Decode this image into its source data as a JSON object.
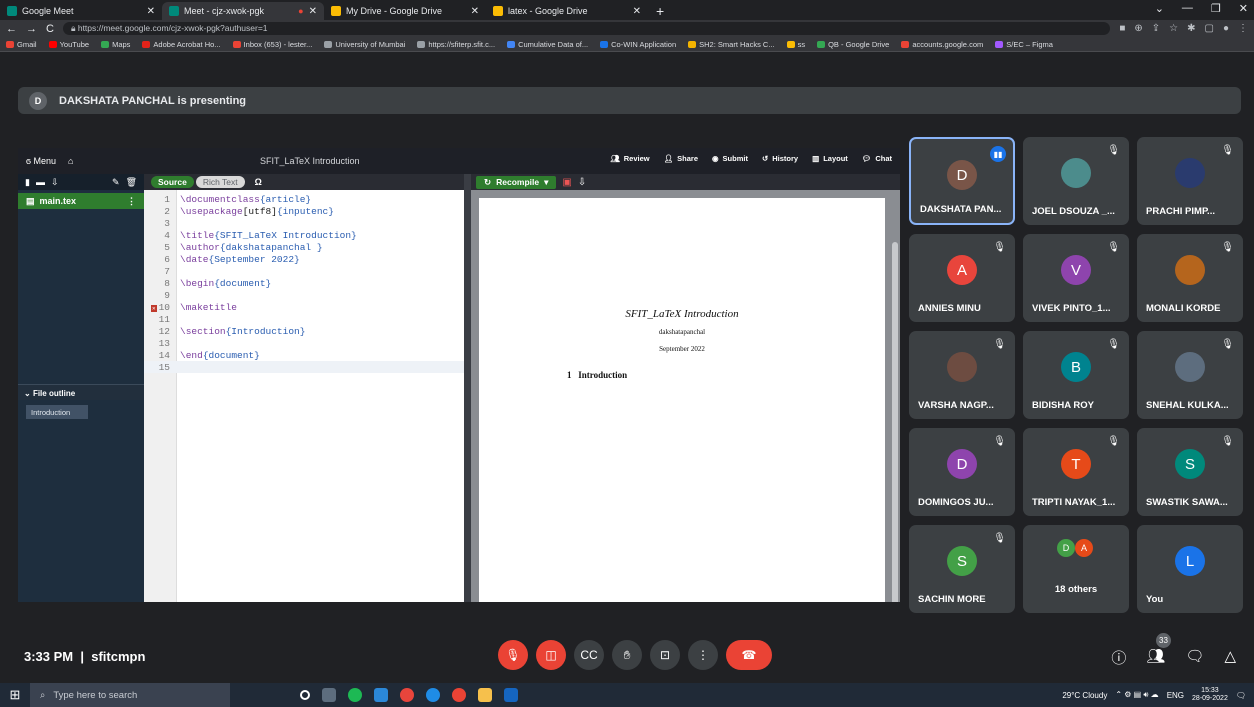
{
  "tabs": [
    {
      "title": "Google Meet",
      "color": "#00897b",
      "active": false
    },
    {
      "title": "Meet - cjz-xwok-pgk",
      "color": "#00897b",
      "active": true
    },
    {
      "title": "My Drive - Google Drive",
      "color": "#fbbc04",
      "active": false
    },
    {
      "title": "latex - Google Drive",
      "color": "#fbbc04",
      "active": false
    }
  ],
  "url": "https://meet.google.com/cjz-xwok-pgk?authuser=1",
  "bookmarks": [
    {
      "label": "Gmail",
      "color": "#ea4335"
    },
    {
      "label": "YouTube",
      "color": "#ff0000"
    },
    {
      "label": "Maps",
      "color": "#34a853"
    },
    {
      "label": "Adobe Acrobat Ho...",
      "color": "#e2231a"
    },
    {
      "label": "Inbox (653) - lester...",
      "color": "#ea4335"
    },
    {
      "label": "University of Mumbai",
      "color": "#9aa0a6"
    },
    {
      "label": "https://sfiterp.sfit.c...",
      "color": "#9aa0a6"
    },
    {
      "label": "Cumulative Data of...",
      "color": "#4285f4"
    },
    {
      "label": "Co-WIN Application",
      "color": "#1a73e8"
    },
    {
      "label": "SH2: Smart Hacks C...",
      "color": "#f4b400"
    },
    {
      "label": "ss",
      "color": "#fbbc04"
    },
    {
      "label": "QB - Google Drive",
      "color": "#34a853"
    },
    {
      "label": "accounts.google.com",
      "color": "#ea4335"
    },
    {
      "label": "S/EC – Figma",
      "color": "#a259ff"
    }
  ],
  "presenter": {
    "initial": "D",
    "text": "DAKSHATA PANCHAL is presenting"
  },
  "overleaf": {
    "menu": "Menu",
    "project": "SFIT_LaTeX Introduction",
    "actions": [
      "Review",
      "Share",
      "Submit",
      "History",
      "Layout",
      "Chat"
    ],
    "source": "Source",
    "richtext": "Rich Text",
    "omega": "Ω",
    "file": "main.tex",
    "outline_label": "File outline",
    "outline_item": "Introduction",
    "recompile": "Recompile",
    "code": [
      {
        "n": "1",
        "t": "\\documentclass{article}"
      },
      {
        "n": "2",
        "t": "\\usepackage[utf8]{inputenc}"
      },
      {
        "n": "3",
        "t": ""
      },
      {
        "n": "4",
        "t": "\\title{SFIT_LaTeX Introduction}"
      },
      {
        "n": "5",
        "t": "\\author{dakshatapanchal }"
      },
      {
        "n": "6",
        "t": "\\date{September 2022}"
      },
      {
        "n": "7",
        "t": ""
      },
      {
        "n": "8",
        "t": "\\begin{document}"
      },
      {
        "n": "9",
        "t": ""
      },
      {
        "n": "10",
        "t": "\\maketitle"
      },
      {
        "n": "11",
        "t": ""
      },
      {
        "n": "12",
        "t": "\\section{Introduction}"
      },
      {
        "n": "13",
        "t": ""
      },
      {
        "n": "14",
        "t": "\\end{document}"
      },
      {
        "n": "15",
        "t": ""
      }
    ],
    "pdf_title": "SFIT_LaTeX Introduction",
    "pdf_author": "dakshatapanchal",
    "pdf_date": "September 2022",
    "pdf_section_num": "1",
    "pdf_section": "Introduction"
  },
  "participants": [
    {
      "name": "DAKSHATA PAN...",
      "initial": "D",
      "color": "#795548",
      "speaking": true
    },
    {
      "name": "JOEL DSOUZA _...",
      "initial": "",
      "color": "#4c8c8c"
    },
    {
      "name": "PRACHI PIMP...",
      "initial": "",
      "color": "#2a3b6e"
    },
    {
      "name": "ANNIES MINU",
      "initial": "A",
      "color": "#e8453c"
    },
    {
      "name": "VIVEK PINTO_1...",
      "initial": "V",
      "color": "#8e44ad"
    },
    {
      "name": "MONALI KORDE",
      "initial": "",
      "color": "#b5651d"
    },
    {
      "name": "VARSHA NAGP...",
      "initial": "",
      "color": "#6d4c41"
    },
    {
      "name": "BIDISHA ROY",
      "initial": "B",
      "color": "#00838f"
    },
    {
      "name": "SNEHAL KULKA...",
      "initial": "",
      "color": "#5d6d7e"
    },
    {
      "name": "DOMINGOS JU...",
      "initial": "D",
      "color": "#8e44ad"
    },
    {
      "name": "TRIPTI NAYAK_1...",
      "initial": "T",
      "color": "#e64a19"
    },
    {
      "name": "SWASTIK SAWA...",
      "initial": "S",
      "color": "#00897b"
    },
    {
      "name": "SACHIN MORE",
      "initial": "S",
      "color": "#43a047"
    },
    {
      "name": "18 others",
      "initial": "",
      "color": "#3c4043"
    },
    {
      "name": "You",
      "initial": "L",
      "color": "#1a73e8"
    }
  ],
  "others_avatars": [
    "D",
    "A"
  ],
  "meeting": {
    "time": "3:33 PM",
    "code": "sfitcmpn",
    "people_count": "33"
  },
  "taskbar": {
    "search": "Type here to search",
    "weather": "29°C  Cloudy",
    "lang": "ENG",
    "time": "15:33",
    "date": "28-09-2022"
  }
}
